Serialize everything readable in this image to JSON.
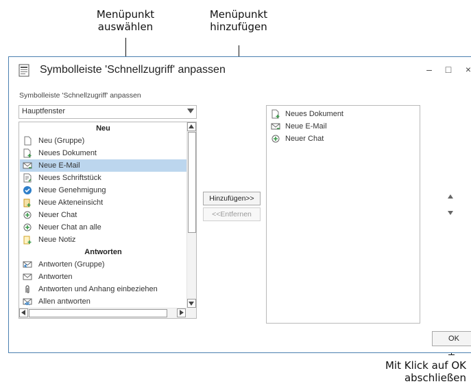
{
  "callouts": {
    "select": [
      "Menüpunkt",
      "auswählen"
    ],
    "add": [
      "Menüpunkt",
      "hinzufügen"
    ],
    "ok": [
      "Mit Klick auf OK",
      "abschließen"
    ]
  },
  "dialog": {
    "title": "Symbolleiste 'Schnellzugriff' anpassen",
    "subtitle": "Symbolleiste 'Schnellzugriff' anpassen",
    "minimize": "–",
    "maximize": "□",
    "close": "×"
  },
  "combo": {
    "value": "Hauptfenster"
  },
  "left_list": {
    "group_new": "Neu",
    "group_reply": "Antworten",
    "items_new": [
      {
        "label": "Neu (Gruppe)",
        "icon": "blank-doc-icon"
      },
      {
        "label": "Neues Dokument",
        "icon": "new-document-icon"
      },
      {
        "label": "Neue E-Mail",
        "icon": "email-icon",
        "selected": true
      },
      {
        "label": "Neues Schriftstück",
        "icon": "writing-icon"
      },
      {
        "label": "Neue Genehmigung",
        "icon": "approval-icon"
      },
      {
        "label": "Neue Akteneinsicht",
        "icon": "file-view-icon"
      },
      {
        "label": "Neuer Chat",
        "icon": "chat-icon"
      },
      {
        "label": "Neuer Chat an alle",
        "icon": "chat-icon"
      },
      {
        "label": "Neue Notiz",
        "icon": "note-icon"
      }
    ],
    "items_reply": [
      {
        "label": "Antworten (Gruppe)",
        "icon": "reply-icon"
      },
      {
        "label": "Antworten",
        "icon": "reply-icon"
      },
      {
        "label": "Antworten und Anhang einbeziehen",
        "icon": "paperclip-icon"
      },
      {
        "label": "Allen antworten",
        "icon": "reply-all-icon"
      }
    ]
  },
  "buttons": {
    "add": "Hinzufügen>>",
    "remove": "<<Entfernen",
    "ok": "OK"
  },
  "right_list": [
    {
      "label": "Neues Dokument",
      "icon": "new-document-icon"
    },
    {
      "label": "Neue E-Mail",
      "icon": "email-icon"
    },
    {
      "label": "Neuer Chat",
      "icon": "chat-icon"
    }
  ],
  "colors": {
    "selection": "#bcd6ee",
    "border_blue": "#4a7fb0",
    "icon_blue": "#2f7fc9",
    "icon_green": "#3a9a4a",
    "icon_orange": "#e3a21a"
  }
}
